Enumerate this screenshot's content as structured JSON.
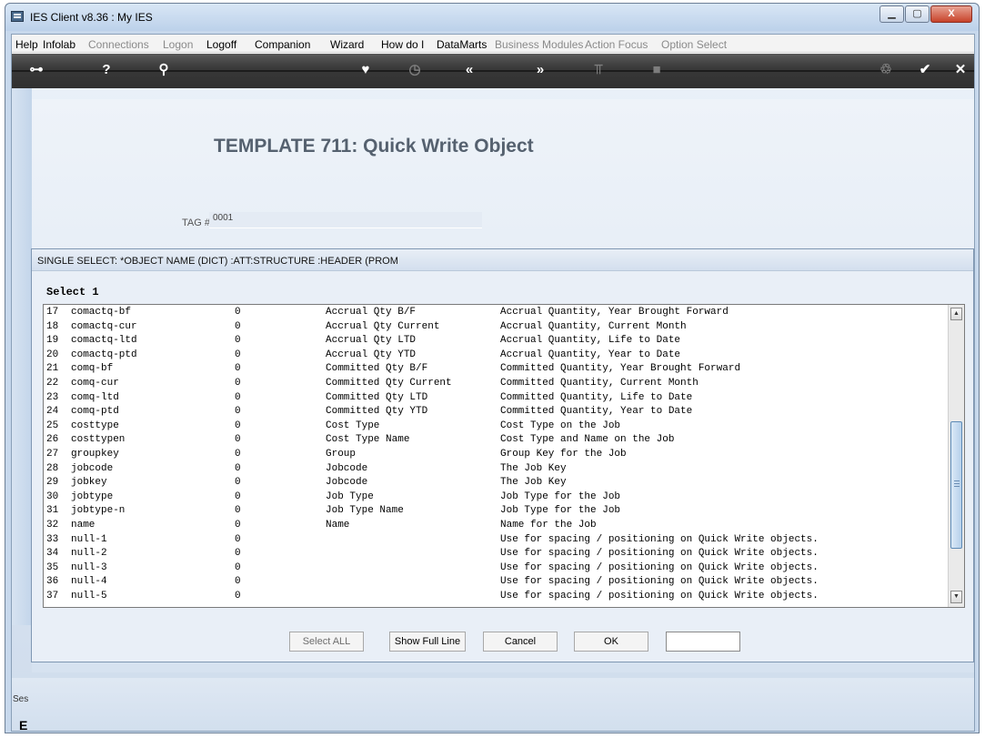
{
  "window": {
    "title": "IES Client v8.36 : My IES",
    "min_glyph": "▁",
    "max_glyph": "▢",
    "close_glyph": "X"
  },
  "menu": [
    {
      "label": "Help",
      "enabled": true
    },
    {
      "label": "Infolab",
      "enabled": true
    },
    {
      "label": "Connections",
      "enabled": false
    },
    {
      "label": "Logon",
      "enabled": false
    },
    {
      "label": "Logoff",
      "enabled": true
    },
    {
      "label": "Companion",
      "enabled": true
    },
    {
      "label": "Wizard",
      "enabled": true
    },
    {
      "label": "How do I",
      "enabled": true
    },
    {
      "label": "DataMarts",
      "enabled": true
    },
    {
      "label": "Business Modules",
      "enabled": false
    },
    {
      "label": "Action Focus",
      "enabled": false
    },
    {
      "label": "Option Select",
      "enabled": false
    }
  ],
  "toolbar": {
    "key": "⊶",
    "help": "?",
    "search": "⚲",
    "heart": "♥",
    "clock": "◷",
    "back": "«",
    "forward": "»",
    "tree": "⫪",
    "stop": "■",
    "recycle": "♲",
    "check": "✔",
    "close": "✕"
  },
  "page": {
    "title": "TEMPLATE 711: Quick Write Object",
    "tag_label": "TAG #",
    "tag_value": "0001"
  },
  "dialog": {
    "title": "SINGLE SELECT: *OBJECT NAME (DICT) :ATT:STRUCTURE :HEADER (PROM",
    "select_label": "Select 1",
    "rows": [
      {
        "no": "17",
        "key": "comactq-bf",
        "val": "0",
        "label": "Accrual Qty B/F",
        "desc": "Accrual Quantity, Year Brought Forward"
      },
      {
        "no": "18",
        "key": "comactq-cur",
        "val": "0",
        "label": "Accrual Qty Current",
        "desc": "Accrual Quantity, Current Month"
      },
      {
        "no": "19",
        "key": "comactq-ltd",
        "val": "0",
        "label": "Accrual Qty LTD",
        "desc": "Accrual Quantity, Life to Date"
      },
      {
        "no": "20",
        "key": "comactq-ptd",
        "val": "0",
        "label": "Accrual Qty YTD",
        "desc": "Accrual Quantity, Year to Date"
      },
      {
        "no": "21",
        "key": "comq-bf",
        "val": "0",
        "label": "Committed Qty B/F",
        "desc": "Committed Quantity, Year Brought Forward"
      },
      {
        "no": "22",
        "key": "comq-cur",
        "val": "0",
        "label": "Committed Qty Current",
        "desc": "Committed Quantity, Current Month"
      },
      {
        "no": "23",
        "key": "comq-ltd",
        "val": "0",
        "label": "Committed Qty LTD",
        "desc": "Committed Quantity, Life to Date"
      },
      {
        "no": "24",
        "key": "comq-ptd",
        "val": "0",
        "label": "Committed Qty YTD",
        "desc": "Committed Quantity, Year to Date"
      },
      {
        "no": "25",
        "key": "costtype",
        "val": "0",
        "label": "Cost Type",
        "desc": "Cost Type on the Job"
      },
      {
        "no": "26",
        "key": "costtypen",
        "val": "0",
        "label": "Cost Type Name",
        "desc": "Cost Type and Name on the Job"
      },
      {
        "no": "27",
        "key": "groupkey",
        "val": "0",
        "label": "Group",
        "desc": "Group Key for the Job"
      },
      {
        "no": "28",
        "key": "jobcode",
        "val": "0",
        "label": "Jobcode",
        "desc": "The Job Key"
      },
      {
        "no": "29",
        "key": "jobkey",
        "val": "0",
        "label": "Jobcode",
        "desc": "The Job Key"
      },
      {
        "no": "30",
        "key": "jobtype",
        "val": "0",
        "label": "Job Type",
        "desc": "Job Type for the Job"
      },
      {
        "no": "31",
        "key": "jobtype-n",
        "val": "0",
        "label": "Job Type Name",
        "desc": "Job Type for the Job"
      },
      {
        "no": "32",
        "key": "name",
        "val": "0",
        "label": "Name",
        "desc": "Name for the Job"
      },
      {
        "no": "33",
        "key": "null-1",
        "val": "0",
        "label": "",
        "desc": "Use for spacing / positioning on Quick Write objects."
      },
      {
        "no": "34",
        "key": "null-2",
        "val": "0",
        "label": "",
        "desc": "Use for spacing / positioning on Quick Write objects."
      },
      {
        "no": "35",
        "key": "null-3",
        "val": "0",
        "label": "",
        "desc": "Use for spacing / positioning on Quick Write objects."
      },
      {
        "no": "36",
        "key": "null-4",
        "val": "0",
        "label": "",
        "desc": "Use for spacing / positioning on Quick Write objects."
      },
      {
        "no": "37",
        "key": "null-5",
        "val": "0",
        "label": "",
        "desc": "Use for spacing / positioning on Quick Write objects."
      }
    ],
    "scroll_up_glyph": "▲",
    "scroll_down_glyph": "▼",
    "buttons": {
      "select_all": "Select ALL",
      "show_full_line": "Show Full Line",
      "cancel": "Cancel",
      "ok": "OK"
    },
    "input_value": ""
  },
  "footer": {
    "session_label": "Ses",
    "session_icon": "E"
  }
}
